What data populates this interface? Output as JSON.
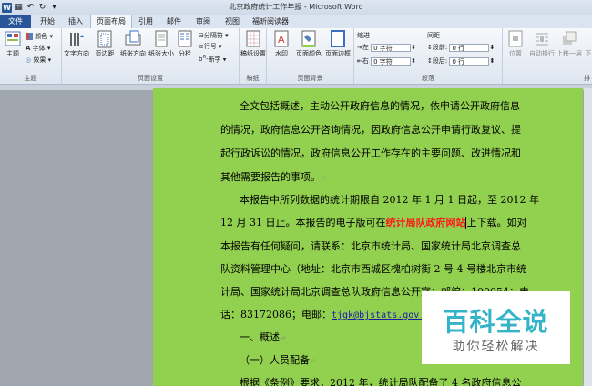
{
  "window": {
    "title": "北京政府统计工作年报 - Microsoft Word"
  },
  "tabs": [
    "文件",
    "开始",
    "插入",
    "页面布局",
    "引用",
    "邮件",
    "审阅",
    "视图",
    "福昕阅读器"
  ],
  "ribbon": {
    "theme": {
      "label": "主题",
      "colors": "颜色",
      "fonts": "字体",
      "effects": "效果",
      "group": "主题"
    },
    "page_setup": {
      "buttons": [
        "文字方向",
        "页边距",
        "纸张方向",
        "纸张大小",
        "分栏"
      ],
      "breaks": "分隔符",
      "line_numbers": "行号",
      "hyphenation": "断字",
      "group": "页面设置"
    },
    "draft": {
      "label": "稿纸设置",
      "group": "稿纸"
    },
    "page_bg": {
      "buttons": [
        "水印",
        "页面颜色",
        "页面边框"
      ],
      "group": "页面背景"
    },
    "indent": {
      "title": "缩进",
      "left_label": "左",
      "left_val": "0 字符",
      "right_label": "右",
      "right_val": "0 字符"
    },
    "spacing": {
      "title": "间距",
      "before_label": "段前",
      "before_val": "0 行",
      "after_label": "段后",
      "after_val": "0 行"
    },
    "paragraph_group": "段落",
    "arrange": {
      "position": "位置",
      "wrap": "自动换行",
      "forward": "上移一层",
      "back": "下"
    },
    "arrange_group": "排"
  },
  "document": {
    "lines": [
      "全文包括概述，主动公开政府信息的情况，依申请公开政府信息",
      "的情况，政府信息公开咨询情况，因政府信息公开申请行政复议、提",
      "起行政诉讼的情况，政府信息公开工作存在的主要问题、改进情况和",
      "其他需要报告的事项。",
      "本报告中所列数据的统计期限自 2012 年 1 月 1 日起，至 2012 年"
    ],
    "line6_pre": "12 月 31 日止。本报告的电子版可在",
    "line6_red": "统计局队政府网站",
    "line6_post": "上下载。如对",
    "lines_b": [
      "本报告有任何疑问，请联系：北京市统计局、国家统计局北京调查总",
      "队资料管理中心（地址：北京市西城区槐柏树街 2 号 4 号楼北京市统",
      "计局、国家统计局北京调查总队政府信息公开室；邮编：100054；电"
    ],
    "line10_pre": "话：83172086；电邮：",
    "line10_link": "tjgk@bjstats.gov.cn",
    "line11": "一、概述",
    "line12": "（一）人员配备",
    "line13": "根据《条例》要求，2012 年，统计局队配备了 4 名政府信息公",
    "mark": "↵"
  },
  "watermark": {
    "title": "百科全说",
    "subtitle": "助你轻松解决"
  }
}
